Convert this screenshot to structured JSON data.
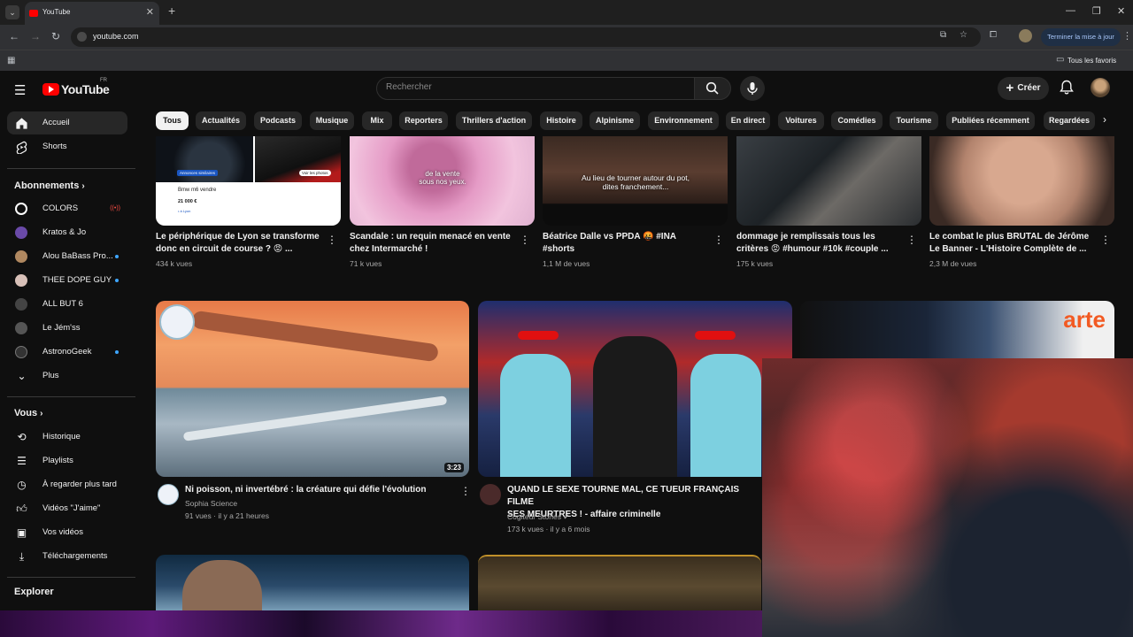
{
  "browser": {
    "tab_title": "YouTube",
    "url": "youtube.com",
    "update_button": "Terminer la mise à jour",
    "bookmarks_all": "Tous les favoris"
  },
  "header": {
    "logo_text": "YouTube",
    "country_code": "FR",
    "search_placeholder": "Rechercher",
    "create_label": "Créer"
  },
  "sidebar": {
    "main": [
      {
        "label": "Accueil",
        "icon": "home-icon"
      },
      {
        "label": "Shorts",
        "icon": "shorts-icon"
      }
    ],
    "subscriptions_title": "Abonnements",
    "subscriptions": [
      {
        "label": "COLORS",
        "badge": "((•))",
        "avatar_color": "#ffffff"
      },
      {
        "label": "Kratos & Jo",
        "avatar_color": "#6a4aa8"
      },
      {
        "label": "Alou BaBass Pro...",
        "avatar_color": "#b08860",
        "new": true
      },
      {
        "label": "THEE DOPE GUY",
        "avatar_color": "#d8c0b8",
        "new": true
      },
      {
        "label": "ALL BUT 6",
        "avatar_color": "#444444"
      },
      {
        "label": "Le Jém'ss",
        "avatar_color": "#555555"
      },
      {
        "label": "AstronoGeek",
        "avatar_color": "#333333",
        "new": true
      }
    ],
    "more_label": "Plus",
    "you_title": "Vous",
    "you_items": [
      {
        "label": "Historique",
        "icon": "history-icon"
      },
      {
        "label": "Playlists",
        "icon": "playlists-icon"
      },
      {
        "label": "À regarder plus tard",
        "icon": "watch-later-icon"
      },
      {
        "label": "Vidéos \"J'aime\"",
        "icon": "like-icon"
      },
      {
        "label": "Vos vidéos",
        "icon": "your-videos-icon"
      },
      {
        "label": "Téléchargements",
        "icon": "downloads-icon"
      }
    ],
    "explore_title": "Explorer"
  },
  "chips": [
    "Tous",
    "Actualités",
    "Podcasts",
    "Musique",
    "Mix",
    "Reporters",
    "Thrillers d'action",
    "Histoire",
    "Alpinisme",
    "Environnement",
    "En direct",
    "Voitures",
    "Comédies",
    "Tourisme",
    "Publiées récemment",
    "Regardées"
  ],
  "row1": [
    {
      "title1": "Le périphérique de Lyon se transforme",
      "title2": "donc en circuit de course ? 😡 ...",
      "meta": "434 k vues",
      "thumb": {
        "ad_tag": "Annonces similaires",
        "car": "Bmw m6 vendre",
        "price": "21 000 €",
        "photos": "Voir les photos",
        "place": "• à Lyon"
      }
    },
    {
      "title1": "Scandale : un requin menacé en vente",
      "title2": "chez Intermarché !",
      "meta": "71 k vues",
      "overlay": "de la vente\nsous nos yeux."
    },
    {
      "title1": "Béatrice Dalle vs PPDA 🤬 #INA",
      "title2": "#shorts",
      "meta": "1,1 M de vues",
      "overlay": "Au lieu de tourner autour du pot,\ndites franchement..."
    },
    {
      "title1": "dommage je remplissais tous les",
      "title2": "critères 😡 #humour #10k #couple ...",
      "meta": "175 k vues"
    },
    {
      "title1": "Le combat le plus BRUTAL de Jérôme",
      "title2": "Le Banner - L'Histoire Complète de ...",
      "meta": "2,3 M de vues"
    }
  ],
  "row2": [
    {
      "title1": "Ni poisson, ni invertébré : la créature qui défie l'évolution",
      "title2": "",
      "channel": "Sophia Science",
      "meta": "91 vues · il y a 21 heures",
      "duration": "3:23"
    },
    {
      "title1": "QUAND LE SEXE TOURNE MAL, CE TUEUR FRANÇAIS FILME",
      "title2": "SES MEURTRES ! - affaire criminelle",
      "channel": "Cogiteur Stories ✔",
      "meta": "173 k vues · il y a 6 mois"
    },
    {
      "brand": "arte"
    }
  ]
}
